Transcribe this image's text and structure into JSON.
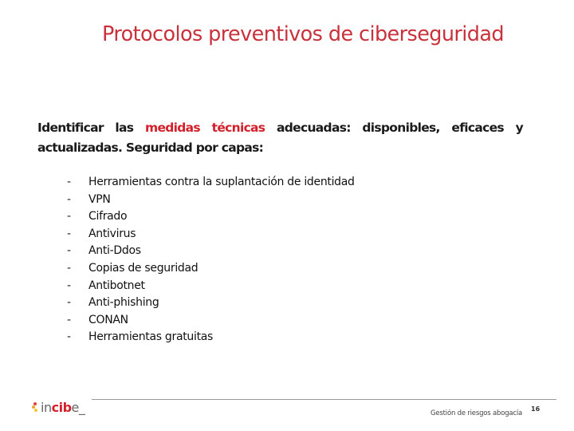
{
  "slide": {
    "title": "Protocolos preventivos de ciberseguridad",
    "intro": {
      "part1": "Identificar las ",
      "highlight": "medidas técnicas",
      "part2": " adecuadas: disponibles, eficaces y",
      "line2": "actualizadas. Seguridad por capas:"
    },
    "bullet_marker": "-",
    "items": [
      "Herramientas contra la suplantación de identidad",
      "VPN",
      "Cifrado",
      "Antivirus",
      "Anti-Ddos",
      "Copias de seguridad",
      "Antibotnet",
      "Anti-phishing",
      "CONAN",
      "Herramientas gratuitas"
    ]
  },
  "footer": {
    "logo": {
      "thin": "in",
      "bold": "cib",
      "tail": "e",
      "underscore": "_"
    },
    "text": "Gestión de riesgos abogacía",
    "page_number": "16"
  },
  "colors": {
    "title": "#c8323c",
    "highlight": "#d3202a",
    "divider": "#9a9a9a"
  }
}
